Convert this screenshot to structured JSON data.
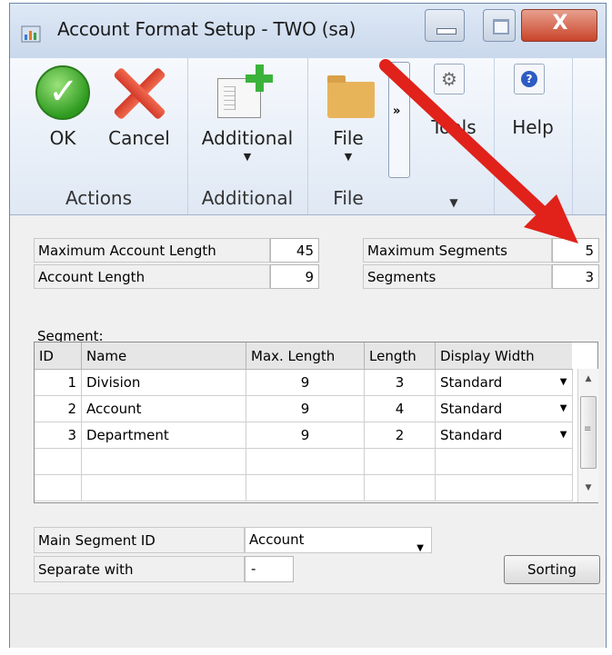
{
  "window": {
    "title": "Account Format Setup  -  TWO (sa)",
    "close_glyph": "X",
    "icons": [
      "app-icon",
      "minimize-icon",
      "maximize-icon",
      "close-icon"
    ]
  },
  "ribbon": {
    "groups": {
      "actions": "Actions",
      "additional": "Additional",
      "file": "File"
    },
    "buttons": {
      "ok": "OK",
      "cancel": "Cancel",
      "additional": "Additional",
      "file": "File",
      "tools": "Tools",
      "help": "Help",
      "overflow": "»"
    }
  },
  "header_fields": {
    "max_account_length_label": "Maximum Account Length",
    "max_account_length_value": "45",
    "account_length_label": "Account Length",
    "account_length_value": "9",
    "max_segments_label": "Maximum Segments",
    "max_segments_value": "5",
    "segments_label": "Segments",
    "segments_value": "3"
  },
  "segment_grid": {
    "caption": "Segment:",
    "columns": [
      "ID",
      "Name",
      "Max. Length",
      "Length",
      "Display Width"
    ],
    "rows": [
      {
        "id": "1",
        "name": "Division",
        "max_length": "9",
        "length": "3",
        "display_width": "Standard"
      },
      {
        "id": "2",
        "name": "Account",
        "max_length": "9",
        "length": "4",
        "display_width": "Standard"
      },
      {
        "id": "3",
        "name": "Department",
        "max_length": "9",
        "length": "2",
        "display_width": "Standard"
      }
    ]
  },
  "footer_fields": {
    "main_segment_label": "Main Segment ID",
    "main_segment_value": "Account",
    "separate_label": "Separate with",
    "separate_value": "-",
    "sorting_button": "Sorting"
  },
  "colors": {
    "annotation_arrow": "#e0221b",
    "ribbon_bg": "#e6eef8"
  }
}
